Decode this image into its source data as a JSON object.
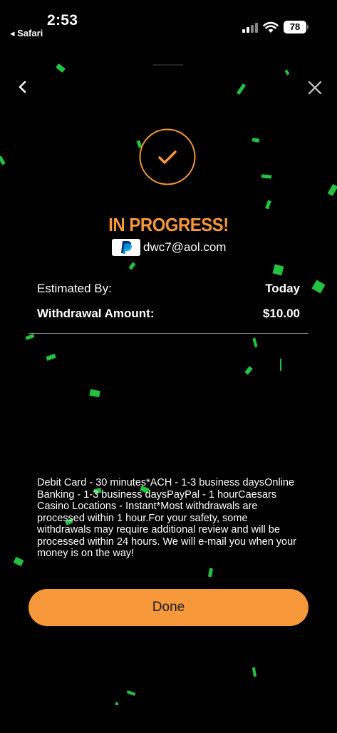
{
  "status_bar": {
    "time": "2:53",
    "back_app": "◂ Safari",
    "battery": "78"
  },
  "status": {
    "headline": "IN PROGRESS!",
    "account_email": "dwc7@aol.com",
    "payment_method_icon": "paypal-icon"
  },
  "details": {
    "estimated_label": "Estimated By:",
    "estimated_value": "Today",
    "amount_label": "Withdrawal Amount:",
    "amount_value": "$10.00"
  },
  "info_text": "Debit Card - 30 minutes*ACH - 1-3 business daysOnline Banking - 1-3 business daysPayPal - 1 hourCaesars Casino Locations - Instant*Most withdrawals are processed within 1 hour.For your safety, some withdrawals may require additional review and will be processed within 24 hours. We will e-mail you when your money is on the way!",
  "done_button": "Done",
  "colors": {
    "accent": "#f7983a",
    "background": "#000000",
    "confetti": "#22c43f"
  }
}
